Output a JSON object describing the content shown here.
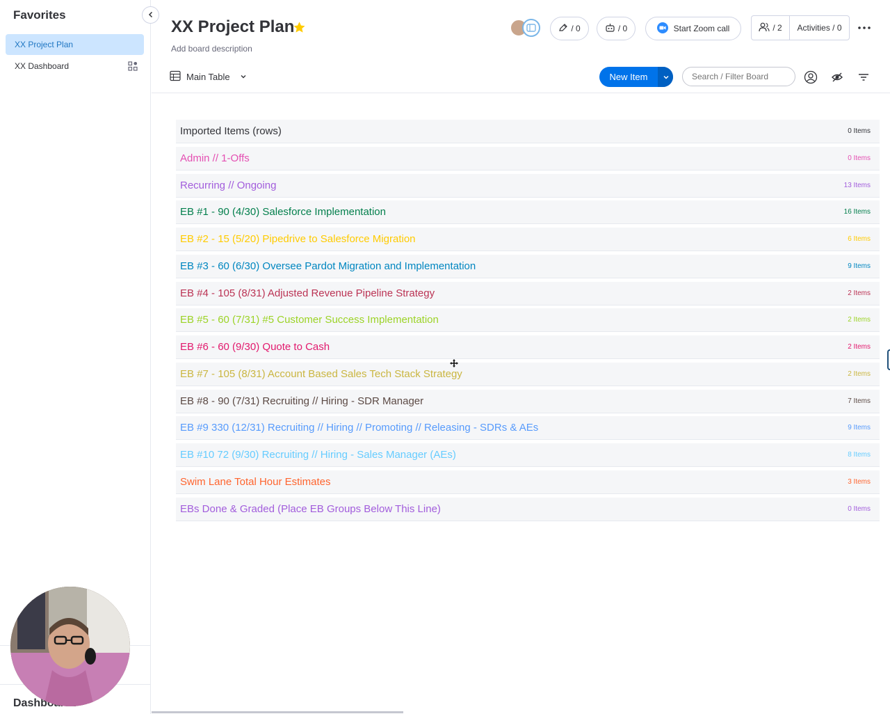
{
  "sidebar": {
    "title": "Favorites",
    "items": [
      {
        "label": "XX Project Plan",
        "active": true
      },
      {
        "label": "XX Dashboard",
        "active": false
      }
    ],
    "bottom_label": "Dashboards"
  },
  "board": {
    "title": "XX Project Plan",
    "description_placeholder": "Add board description",
    "starred": true
  },
  "header": {
    "updates_count": "/ 0",
    "automations_count": "/ 0",
    "zoom_label": "Start Zoom call",
    "members_count": "/ 2",
    "activities_label": "Activities / 0"
  },
  "toolbar": {
    "view_label": "Main Table",
    "new_item_label": "New Item",
    "search_placeholder": "Search / Filter Board"
  },
  "groups": [
    {
      "name": "Imported Items (rows)",
      "count": "0 Items",
      "color": "#323338"
    },
    {
      "name": "Admin // 1-Offs",
      "count": "0 Items",
      "color": "#e44fb2"
    },
    {
      "name": "Recurring // Ongoing",
      "count": "13 Items",
      "color": "#a25ddc"
    },
    {
      "name": "EB #1 - 90 (4/30) Salesforce Implementation",
      "count": "16 Items",
      "color": "#037f4c"
    },
    {
      "name": "EB #2 - 15 (5/20) Pipedrive to Salesforce Migration",
      "count": "6 Items",
      "color": "#ffcb00"
    },
    {
      "name": "EB #3 - 60 (6/30) Oversee Pardot Migration and Implementation",
      "count": "9 Items",
      "color": "#0086c0"
    },
    {
      "name": "EB #4 - 105 (8/31) Adjusted Revenue Pipeline Strategy",
      "count": "2 Items",
      "color": "#bb3354"
    },
    {
      "name": "EB #5 - 60 (7/31) #5 Customer Success Implementation",
      "count": "2 Items",
      "color": "#9cd326"
    },
    {
      "name": "EB #6 - 60 (9/30) Quote to Cash",
      "count": "2 Items",
      "color": "#e2196d"
    },
    {
      "name": "EB #7 - 105 (8/31) Account Based Sales Tech Stack Strategy",
      "count": "2 Items",
      "color": "#cab641"
    },
    {
      "name": "EB #8 - 90 (7/31) Recruiting // Hiring - SDR Manager",
      "count": "7 Items",
      "color": "#5c4a45"
    },
    {
      "name": "EB #9 330 (12/31) Recruiting // Hiring // Promoting // Releasing - SDRs & AEs",
      "count": "9 Items",
      "color": "#579bfc"
    },
    {
      "name": "EB #10 72 (9/30) Recruiting // Hiring - Sales Manager (AEs)",
      "count": "8 Items",
      "color": "#66ccff"
    },
    {
      "name": "Swim Lane Total Hour Estimates",
      "count": "3 Items",
      "color": "#ff642e"
    },
    {
      "name": "EBs Done & Graded (Place EB Groups Below This Line)",
      "count": "0 Items",
      "color": "#a25ddc"
    }
  ],
  "colors": {
    "accent": "#0073ea",
    "sidebar_active_bg": "#cce5ff",
    "star": "#ffcb00"
  }
}
